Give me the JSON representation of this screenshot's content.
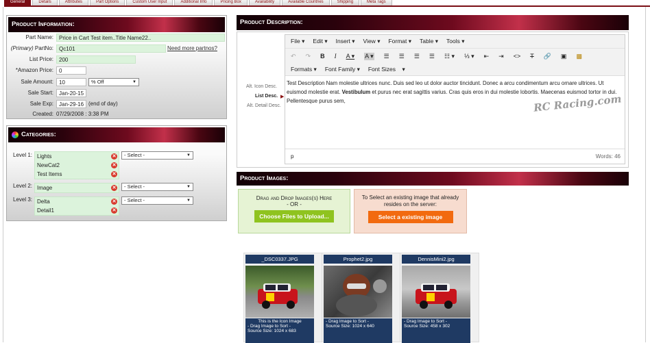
{
  "tabs": [
    "General",
    "Details",
    "Attributes",
    "Part Options",
    "Custom User Input",
    "Additional Info",
    "Pricing Box",
    "Availability",
    "Available Countries",
    "Shipping",
    "Meta Tags"
  ],
  "product_info": {
    "heading": "Product Information:",
    "part_name_label": "Part Name:",
    "part_name": "Price in Cart Test item..Title Name22..",
    "partno_prefix": "(Primary)",
    "partno_label": "PartNo:",
    "partno": "Qc101",
    "more_partnos": "Need more partnos?",
    "list_price_label": "List Price:",
    "list_price": "200",
    "amazon_label": "*Amazon Price:",
    "amazon_price": "0",
    "sale_amount_label": "Sale Amount:",
    "sale_amount": "10",
    "sale_type": "% Off",
    "sale_start_label": "Sale Start:",
    "sale_start": "Jan-20-15",
    "sale_exp_label": "Sale Exp:",
    "sale_exp": "Jan-29-16",
    "end_of_day": "(end of day)",
    "created_label": "Created:",
    "created": "07/29/2008 : 3:38 PM"
  },
  "categories": {
    "heading": "Categories:",
    "level1_label": "Level 1:",
    "level1_items": [
      "Lights",
      "NewCat2",
      "Test Items"
    ],
    "level2_label": "Level 2:",
    "level2_items": [
      "Image"
    ],
    "level3_label": "Level 3:",
    "level3_items": [
      "Delta",
      "Detail1"
    ],
    "select_placeholder": "- Select -"
  },
  "description": {
    "heading": "Product Description:",
    "alt_icon": "Alt. Icon Desc.",
    "list_desc": "List Desc.",
    "alt_detail": "Alt. Detail Desc.",
    "menus": [
      "File",
      "Edit",
      "Insert",
      "View",
      "Format",
      "Table",
      "Tools"
    ],
    "formats": "Formats",
    "font_family": "Font Family",
    "font_sizes": "Font Sizes",
    "content_pre": "Test Description Nam molestie ultrices nunc. Duis sed leo ut dolor auctor tincidunt. Donec a arcu condimentum arcu ornare ultrices. Ut euismod molestie erat. ",
    "content_bold": "Vestibulum",
    "content_post": " et purus nec erat sagittis varius. Cras quis eros in dui molestie lobortis. Maecenas euismod tortor in dui. Pellentesque purus sem,",
    "watermark": "RC Racing.com",
    "status_path": "p",
    "word_count": "Words: 46"
  },
  "images": {
    "heading": "Product Images:",
    "drag_title": "Drag and Drop Images(s) Here",
    "or": "- OR -",
    "upload_btn": "Choose Files to Upload...",
    "select_text": "To Select an existing image that already resides on the server:",
    "select_btn": "Select a existing image",
    "items": [
      {
        "name": "_DSC0337.JPG",
        "desc1": "This is the Icon Image",
        "desc2": "- Drag Image to Sort -",
        "desc3": "Source Size: 1024 x 683"
      },
      {
        "name": "Prophet2.jpg",
        "desc1": "- Drag Image to Sort -",
        "desc2": "Source Size: 1024 x 640",
        "desc3": ""
      },
      {
        "name": "DennisMini2.jpg",
        "desc1": "- Drag Image to Sort -",
        "desc2": "Source Size: 458 x 302",
        "desc3": ""
      }
    ]
  },
  "colors": {
    "accent": "#7a0d14",
    "green_btn": "#8fc31f",
    "orange_btn": "#f26a0f",
    "img_blue": "#1f3a63"
  }
}
